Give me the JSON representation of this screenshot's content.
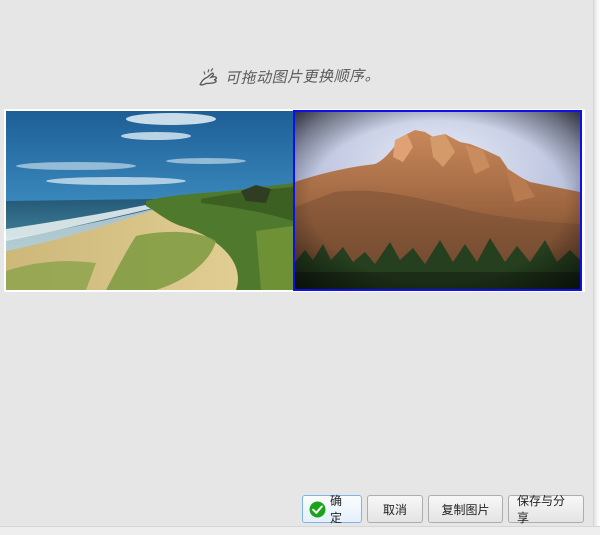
{
  "hint": {
    "text": "可拖动图片更换顺序。",
    "icon": "drag-hand-icon"
  },
  "images": [
    {
      "name": "beach-dunes-photo",
      "selected": false
    },
    {
      "name": "rocky-mountain-photo",
      "selected": true
    }
  ],
  "buttons": {
    "ok_label": "确定",
    "ok_icon": "check-circle-icon",
    "cancel_label": "取消",
    "copy_label": "复制图片",
    "save_label": "保存与分享"
  },
  "colors": {
    "selection_border": "#0f0fe8",
    "check_green": "#1aa31a",
    "background": "#e6e6e6"
  }
}
